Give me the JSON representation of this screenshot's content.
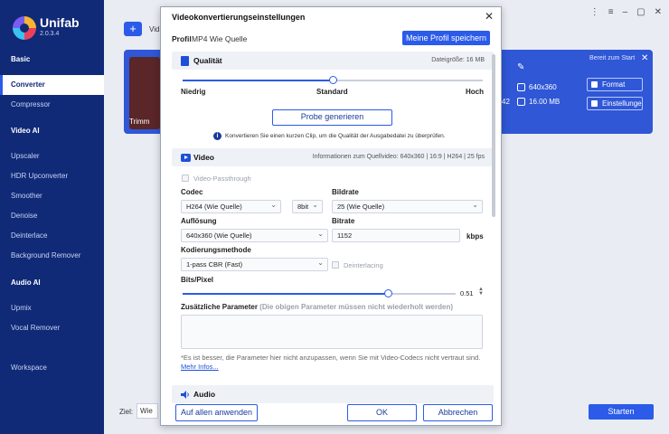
{
  "app": {
    "name": "Unifab",
    "version": "2.0.3.4"
  },
  "sidebar": {
    "sections": [
      {
        "label": "Basic",
        "items": [
          "Converter",
          "Compressor"
        ]
      },
      {
        "label": "Video AI",
        "items": [
          "Upscaler",
          "HDR Upconverter",
          "Smoother",
          "Denoise",
          "Deinterlace",
          "Background Remover"
        ]
      },
      {
        "label": "Audio AI",
        "items": [
          "Upmix",
          "Vocal Remover"
        ]
      },
      {
        "label": "",
        "items": [
          "Workspace"
        ]
      }
    ],
    "active": "Converter"
  },
  "background": {
    "add_label": "Vid",
    "trim_label": "Trimm",
    "ready_label": "Bereit zum Start",
    "resolution": "640x360",
    "size": "16.00 MB",
    "partial_num": "42",
    "format_btn": "Format",
    "settings_btn": "Einstellunge",
    "ziel_label": "Ziel:",
    "ziel_value": "Wie Q",
    "start_btn": "Starten"
  },
  "dialog": {
    "title": "Videokonvertierungseinstellungen",
    "profile_label": "Profil",
    "profile_value": "MP4 Wie Quelle",
    "save_profile_btn": "Meine Profil speichern",
    "quality": {
      "title": "Qualität",
      "file_size": "Dateigröße: 16 MB",
      "low": "Niedrig",
      "standard": "Standard",
      "high": "Hoch",
      "level": 0.5,
      "probe_btn": "Probe generieren",
      "info": "Konvertieren Sie einen kurzen Clip, um die Qualität der Ausgabedatei zu überprüfen."
    },
    "video": {
      "title": "Video",
      "info": "Informationen zum Quellvideo: 640x360 | 16:9 | H264 | 25 fps",
      "passthrough": "Video-Passthrough",
      "codec_label": "Codec",
      "codec_value": "H264 (Wie Quelle)",
      "bit_depth": "8bit",
      "framerate_label": "Bildrate",
      "framerate_value": "25 (Wie Quelle)",
      "resolution_label": "Auflösung",
      "resolution_value": "640x360 (Wie Quelle)",
      "bitrate_label": "Bitrate",
      "bitrate_value": "1152",
      "bitrate_unit": "kbps",
      "encoding_label": "Kodierungsmethode",
      "encoding_value": "1-pass CBR (Fast)",
      "deinterlace": "Deinterlacing",
      "bpp_label": "Bits/Pixel",
      "bpp_value": "0.51",
      "bpp_level": 0.75,
      "params_label": "Zusätzliche Parameter",
      "params_hint": "(Die obigen Parameter müssen nicht wiederholt werden)",
      "note": "*Es ist besser, die Parameter hier nicht anzupassen, wenn Sie mit Video-Codecs nicht vertraut sind.",
      "more_info": "Mehr Infos..."
    },
    "audio": {
      "title": "Audio"
    },
    "apply_all_btn": "Auf allen anwenden",
    "ok_btn": "OK",
    "cancel_btn": "Abbrechen"
  }
}
